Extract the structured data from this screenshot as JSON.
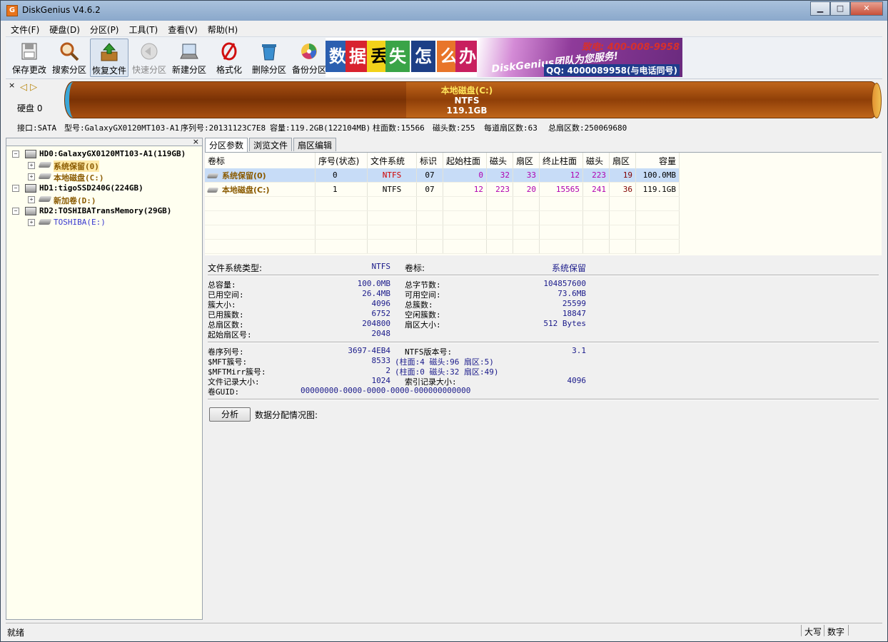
{
  "window": {
    "title": "DiskGenius V4.6.2",
    "app_icon_letter": "G",
    "minimize": "▁",
    "maximize": "□",
    "close": "✕"
  },
  "menu": [
    "文件(F)",
    "硬盘(D)",
    "分区(P)",
    "工具(T)",
    "查看(V)",
    "帮助(H)"
  ],
  "toolbar": {
    "items": [
      {
        "name": "save",
        "label": "保存更改",
        "icon": "save-disk-icon",
        "state": "normal"
      },
      {
        "name": "search",
        "label": "搜索分区",
        "icon": "magnifier-icon",
        "state": "normal"
      },
      {
        "name": "recover",
        "label": "恢复文件",
        "icon": "recover-box-icon",
        "state": "active"
      },
      {
        "name": "quick",
        "label": "快速分区",
        "icon": "quick-partition-icon",
        "state": "disabled"
      },
      {
        "name": "new",
        "label": "新建分区",
        "icon": "new-partition-icon",
        "state": "normal"
      },
      {
        "name": "format",
        "label": "格式化",
        "icon": "format-icon",
        "state": "normal"
      },
      {
        "name": "delete",
        "label": "删除分区",
        "icon": "trash-icon",
        "state": "normal"
      },
      {
        "name": "backup",
        "label": "备份分区",
        "icon": "backup-disc-icon",
        "state": "normal"
      }
    ],
    "banner": {
      "tiles": [
        "数",
        "据",
        "丢",
        "失",
        "怎",
        "么",
        "办"
      ],
      "brand": "DiskGenius团队为您服务!",
      "phone": "致电: 400-008-9958",
      "qq": "QQ: 4000089958(与电话同号)"
    }
  },
  "diskbar": {
    "close": "×",
    "arrows": "◁ ▷",
    "disk_label": "硬盘 0",
    "partition_name": "本地磁盘(C:)",
    "partition_fs": "NTFS",
    "partition_size": "119.1GB"
  },
  "infoline": {
    "interface": "接口:SATA",
    "model": "型号:GalaxyGX0120MT103-A1",
    "serial": "序列号:20131123C7E8",
    "capacity": "容量:119.2GB(122104MB)",
    "cylinders": "柱面数:15566",
    "heads": "磁头数:255",
    "sectors_per_track": "每道扇区数:63",
    "total_sectors": "总扇区数:250069680"
  },
  "tree": {
    "close": "×",
    "nodes": [
      {
        "level": 0,
        "kind": "disk",
        "label": "HD0:GalaxyGX0120MT103-A1(119GB)"
      },
      {
        "level": 1,
        "kind": "part",
        "label": "系统保留(0)",
        "selected": true
      },
      {
        "level": 1,
        "kind": "part",
        "label": "本地磁盘(C:)"
      },
      {
        "level": 0,
        "kind": "disk",
        "label": "HD1:tigoSSD240G(224GB)"
      },
      {
        "level": 1,
        "kind": "part",
        "label": "新加卷(D:)"
      },
      {
        "level": 0,
        "kind": "disk",
        "label": "RD2:TOSHIBATransMemory(29GB)"
      },
      {
        "level": 1,
        "kind": "usb",
        "label": "TOSHIBA(E:)"
      }
    ]
  },
  "tabs": [
    "分区参数",
    "浏览文件",
    "扇区编辑"
  ],
  "partition_table": {
    "headers": [
      "卷标",
      "序号(状态)",
      "文件系统",
      "标识",
      "起始柱面",
      "磁头",
      "扇区",
      "终止柱面",
      "磁头",
      "扇区",
      "容量"
    ],
    "rows": [
      [
        "系统保留(0)",
        "0",
        "NTFS",
        "07",
        "0",
        "32",
        "33",
        "12",
        "223",
        "19",
        "100.0MB"
      ],
      [
        "本地磁盘(C:)",
        "1",
        "NTFS",
        "07",
        "12",
        "223",
        "20",
        "15565",
        "241",
        "36",
        "119.1GB"
      ]
    ]
  },
  "details": {
    "fs_type_label": "文件系统类型:",
    "fs_type": "NTFS",
    "volume_label_label": "卷标:",
    "volume_label": "系统保留",
    "left": [
      [
        "总容量:",
        "100.0MB"
      ],
      [
        "已用空间:",
        "26.4MB"
      ],
      [
        "簇大小:",
        "4096"
      ],
      [
        "已用簇数:",
        "6752"
      ],
      [
        "总扇区数:",
        "204800"
      ],
      [
        "起始扇区号:",
        "2048"
      ]
    ],
    "right": [
      [
        "总字节数:",
        "104857600"
      ],
      [
        "可用空间:",
        "73.6MB"
      ],
      [
        "总簇数:",
        "25599"
      ],
      [
        "空闲簇数:",
        "18847"
      ],
      [
        "扇区大小:",
        "512 Bytes"
      ]
    ],
    "serial_label": "卷序列号:",
    "serial": "3697-4EB4",
    "ntfs_ver_label": "NTFS版本号:",
    "ntfs_ver": "3.1",
    "mft_label": "$MFT簇号:",
    "mft": "8533",
    "mft_loc": "(柱面:4 磁头:96 扇区:5)",
    "mftmirr_label": "$MFTMirr簇号:",
    "mftmirr": "2",
    "mftmirr_loc": "(柱面:0 磁头:32 扇区:49)",
    "record_size_label": "文件记录大小:",
    "record_size": "1024",
    "index_size_label": "索引记录大小:",
    "index_size": "4096",
    "guid_label": "卷GUID:",
    "guid": "00000000-0000-0000-0000-000000000000"
  },
  "analyze": {
    "button": "分析",
    "label": "数据分配情况图:"
  },
  "status": {
    "text": "就绪",
    "caps": "大写",
    "num": "数字"
  }
}
